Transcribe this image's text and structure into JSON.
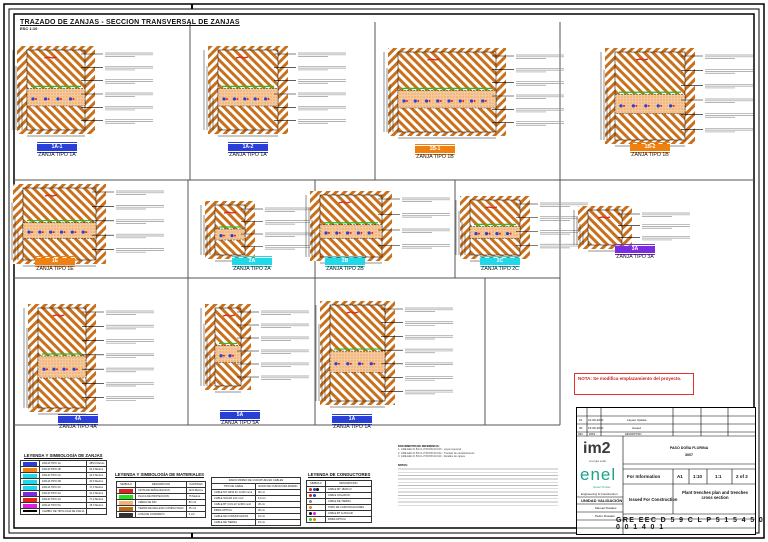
{
  "drawing": {
    "title": "TRAZADO DE ZANJAS - SECCION TRANSVERSAL DE ZANJAS",
    "scale": "ESC 1:10"
  },
  "sections": [
    {
      "badge": "1A-1",
      "label": "ZANJA TIPO 1A",
      "color": "#2a3fd8"
    },
    {
      "badge": "1A-2",
      "label": "ZANJA TIPO 1A",
      "color": "#2a3fd8"
    },
    {
      "badge": "1B-1",
      "label": "ZANJA TIPO 1B",
      "color": "#f08010"
    },
    {
      "badge": "1B-2",
      "label": "ZANJA TIPO 1B",
      "color": "#f08010"
    },
    {
      "badge": "1E",
      "label": "ZANJA TIPO 1E",
      "color": "#f08010"
    },
    {
      "badge": "2A",
      "label": "ZANJA TIPO 2A",
      "color": "#20d8e8"
    },
    {
      "badge": "2B",
      "label": "ZANJA TIPO 2B",
      "color": "#20d8e8"
    },
    {
      "badge": "2C",
      "label": "ZANJA TIPO 2C",
      "color": "#20d8e8"
    },
    {
      "badge": "3A",
      "label": "ZANJA TIPO 3A",
      "color": "#7b2be0"
    },
    {
      "badge": "4A",
      "label": "ZANJA TIPO 4A",
      "color": "#2a3fd8"
    },
    {
      "badge": "5A",
      "label": "ZANJA TIPO 5A",
      "color": "#2a3fd8"
    },
    {
      "badge": "1A",
      "label": "ZANJA TIPO 1A",
      "color": "#2a3fd8"
    }
  ],
  "note": "NOTA: Se modifica emplazamiento del proyecto.",
  "legend_trenches": {
    "title": "LEYENDA Y SIMBOLOGÍA DE ZANJAS",
    "rows": [
      {
        "color": "#2a3fd8",
        "name": "ZANJA TIPO 1A",
        "length": "285,0 Metros"
      },
      {
        "color": "#f08010",
        "name": "ZANJA TIPO 1B",
        "length": "51,0 Metros"
      },
      {
        "color": "#20d8e8",
        "name": "ZANJA TIPO 2A",
        "length": "24,0 Metros"
      },
      {
        "color": "#20d8e8",
        "name": "ZANJA TIPO 2B",
        "length": "20,0 Metros"
      },
      {
        "color": "#20d8e8",
        "name": "ZANJA TIPO 2C",
        "length": "17,0 Metros"
      },
      {
        "color": "#7b2be0",
        "name": "ZANJA TIPO 3A",
        "length": "41,0 Metros"
      },
      {
        "color": "#e82020",
        "name": "ZANJA TIPO 4A",
        "length": "77,0 Metros"
      },
      {
        "color": "#e020e0",
        "name": "ZANJA TIPO 5A",
        "length": "15,0 Metros"
      },
      {
        "color": "#000000",
        "name": "CAMBIO DE TIPOLOGIA DE ZANJA",
        "length": ""
      }
    ]
  },
  "legend_materials": {
    "title": "LEYENDA Y SIMBOLOGÍA DE MATERIALES",
    "headers": [
      "SIMBOLO",
      "DESCRIPCION",
      "CANTIDAD"
    ],
    "rows": [
      {
        "color": "#e02020",
        "desc": "CINTA DE SEÑALIZACION",
        "qty": "1100 Metros"
      },
      {
        "color": "#20e020",
        "desc": "PLACA DE PROTECCION",
        "qty": "75 Metros"
      },
      {
        "color": "#f5b07a",
        "desc": "ARENA DE RIO",
        "qty": "80 m3"
      },
      {
        "color": "#b86a1a",
        "desc": "TIERRA DE RELLENO COMPACTADO",
        "qty": "45 m3"
      },
      {
        "color": "#333333",
        "desc": "LOSA DE CONCRETO",
        "qty": "3 m3"
      }
    ]
  },
  "cable_table": {
    "title": "RADIO MINIMO DE CURVATURA EN CABLES",
    "headers": [
      "TIPO DE CABLE",
      "RADIO DE CURVATURA MINIMO"
    ],
    "rows": [
      [
        "CABLE MT 18/30 kV 1x240 mm2",
        "90 cm"
      ],
      [
        "CABLE SOLAR 1x6 mm2",
        "6,0 cm"
      ],
      [
        "CABLE BT 0,6/1 kV 1x300 mm2",
        "36 cm"
      ],
      [
        "FIBRA OPTICA",
        "30 cm"
      ],
      [
        "CABLE DE COMUNICACION",
        "10 cm"
      ],
      [
        "CABLE DE TIERRA",
        "15 cm"
      ]
    ]
  },
  "legend_conductors": {
    "title": "LEYENDA DE CONDUCTORES",
    "headers": [
      "SIMBOLO",
      "DESCRIPCION"
    ],
    "rows": [
      {
        "colors": [
          "#e02020",
          "#2a3fd8",
          "#111111"
        ],
        "desc": "CABLE MT 18/30 kV"
      },
      {
        "colors": [
          "#e02020",
          "#2a3fd8"
        ],
        "desc": "CABLE SOLAR DC"
      },
      {
        "colors": [
          "#888888"
        ],
        "desc": "CABLE DE TIERRA"
      },
      {
        "colors": [
          "#f08010"
        ],
        "desc": "TUBO DE COMUNICACIONES"
      },
      {
        "colors": [
          "#111111",
          "#e020e0"
        ],
        "desc": "CABLE BT AUXILIAR"
      },
      {
        "colors": [
          "#20d820",
          "#f08010"
        ],
        "desc": "FIBRA OPTICA"
      }
    ]
  },
  "documents": {
    "title": "DOCUMENTOS DE REFERENCIA:",
    "items": [
      "1. GRE.EEC.D.59.CL.P.51545.00.010 - Layout general",
      "2. GRE.EEC.D.59.CL.P.51545.00.012 - Trazado de canalizaciones",
      "3. GRE.EEC.D.59.CL.P.51545.00.013 - Detalles de zanjas"
    ],
    "notes_title": "NOTAS:"
  },
  "title_block": {
    "revisions": [
      {
        "rev": "01",
        "date": "21-09-2020",
        "desc": "Layout Update"
      },
      {
        "rev": "00",
        "date": "15-06-2020",
        "desc": "Issued"
      }
    ],
    "rev_headers": [
      "REV.",
      "DATE",
      "DESCRIPTION"
    ],
    "project": "PASO DOÑA FLORINA",
    "project_sub": "3007",
    "purpose": "For Information",
    "size": "A1",
    "scale": "1:10",
    "plot_scale": "1:1",
    "sheet": "2 of 2",
    "status": "Issued For Construction",
    "drawing_title": "Plant trenches plan and trenches cross section",
    "logo_im2": "im2",
    "logo_im2_sub": "energia solar",
    "logo_enel": "enel",
    "logo_enel_sub": "Green Power",
    "validation": "UNIDAD VALIDACIÓN",
    "engineering": "Engineering & Construction",
    "prepared_by": "Manuel Rosales",
    "approved_by": "Pedro Rosales",
    "doc_number": "GRE EEC D 5 9 C L P 5 1 5 4 5 0 0 0 1 4 0 1"
  }
}
